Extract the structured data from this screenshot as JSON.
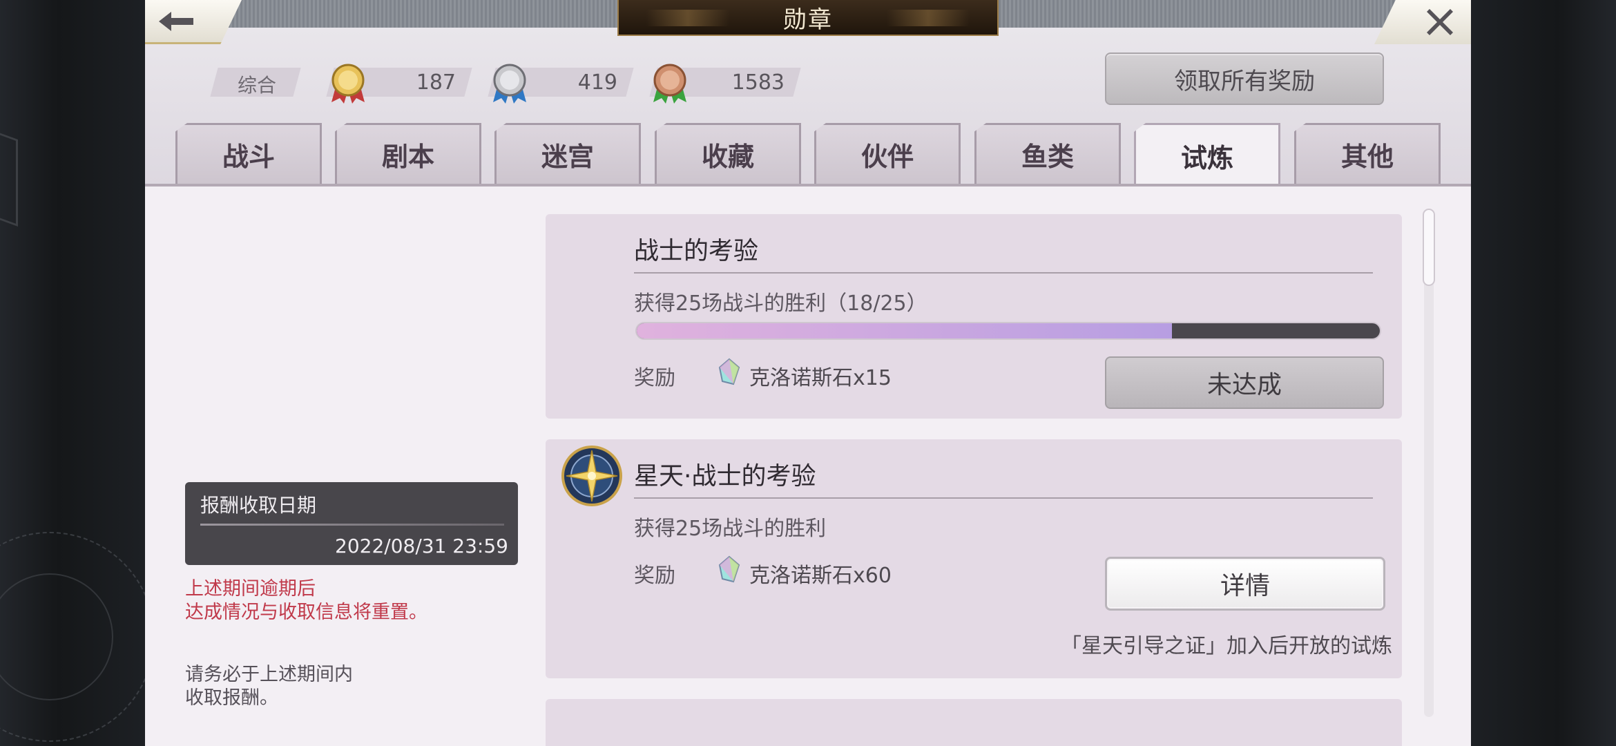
{
  "window": {
    "title": "勋章"
  },
  "medals": {
    "label": "综合",
    "items": [
      {
        "kind": "gold",
        "count": "187"
      },
      {
        "kind": "silver",
        "count": "419"
      },
      {
        "kind": "bronze",
        "count": "1583"
      }
    ]
  },
  "claim_all_label": "领取所有奖励",
  "tabs": [
    {
      "label": "战斗"
    },
    {
      "label": "剧本"
    },
    {
      "label": "迷宫"
    },
    {
      "label": "收藏"
    },
    {
      "label": "伙伴"
    },
    {
      "label": "鱼类"
    },
    {
      "label": "试炼",
      "active": true
    },
    {
      "label": "其他"
    }
  ],
  "sidebar": {
    "date_label": "报酬收取日期",
    "date_value": "2022/08/31 23:59",
    "warning_line1": "上述期间逾期后",
    "warning_line2": "达成情况与收取信息将重置。",
    "note_line1": "请务必于上述期间内",
    "note_line2": "收取报酬。"
  },
  "trials": [
    {
      "title": "战士的考验",
      "desc": "获得25场战斗的胜利（18/25）",
      "progress": 0.72,
      "reward_label": "奖励",
      "reward": "克洛诺斯石x15",
      "button": "未达成"
    },
    {
      "title": "星天·战士的考验",
      "desc": "获得25场战斗的胜利",
      "reward_label": "奖励",
      "reward": "克洛诺斯石x60",
      "button": "详情",
      "note": "「星天引导之证」加入后开放的试炼"
    }
  ],
  "colors": {
    "warning": "#c0394a",
    "progress_fill": "#b79ee2",
    "progress_track": "#4a474d"
  },
  "icons": {
    "back": "back-arrow-icon",
    "close": "close-icon",
    "gem": "crystal-gem-icon",
    "emblem": "star-compass-icon"
  }
}
